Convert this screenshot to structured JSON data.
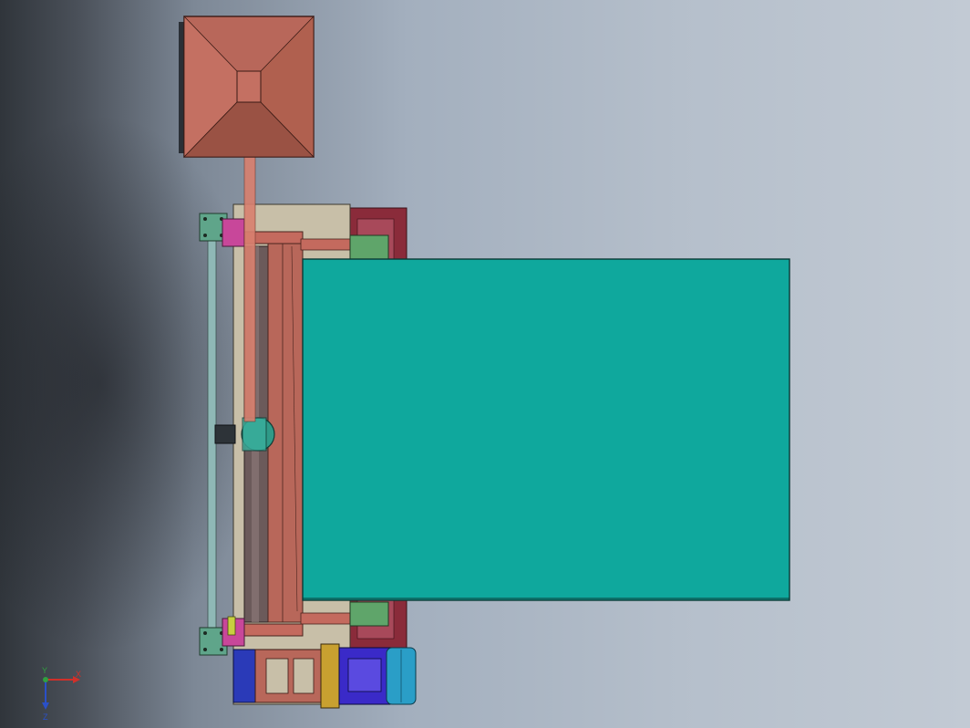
{
  "viewport": {
    "background_left": "#30353b",
    "background_right": "#c2cad4"
  },
  "model": {
    "hopper_color": "#b8675a",
    "frame_color": "#c8bfa8",
    "belt_color": "#0fa89d",
    "motor_color": "#2a9ec7",
    "gearbox_color": "#4a3cc0",
    "shaft_color": "#7fa8a6",
    "accent_magenta": "#c8479a",
    "accent_red": "#8a2b3a"
  },
  "triad": {
    "x_label": "X",
    "y_label": "Y",
    "z_label": "Z",
    "x_color": "#d0302a",
    "y_color": "#30a040",
    "z_color": "#2a50c8"
  }
}
